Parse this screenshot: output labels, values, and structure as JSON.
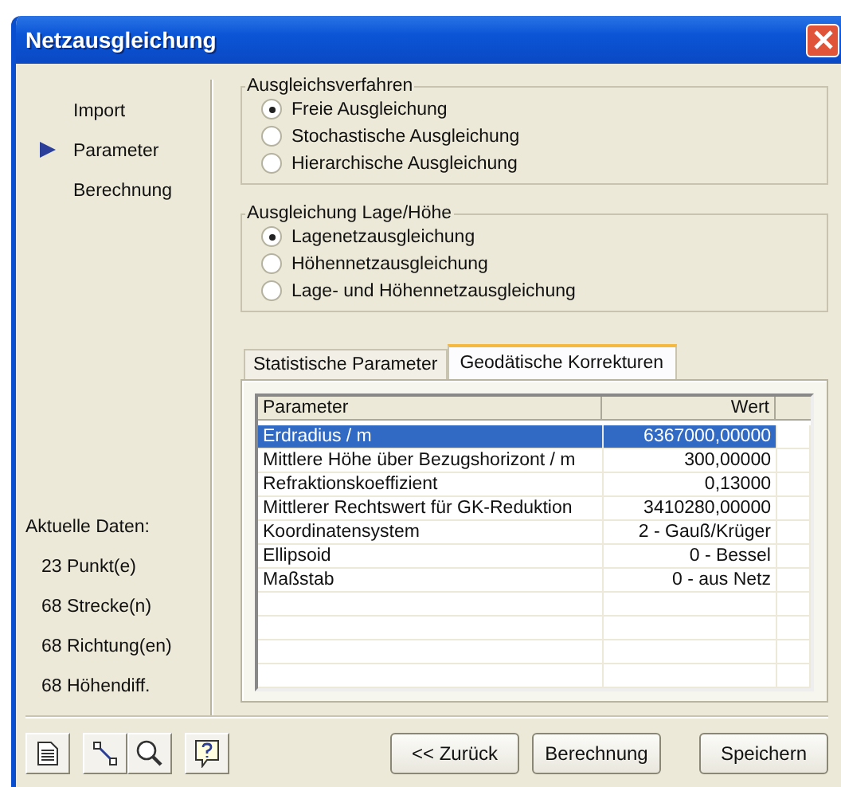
{
  "window": {
    "title": "Netzausgleichung"
  },
  "nav": [
    {
      "label": "Import",
      "selected": false
    },
    {
      "label": "Parameter",
      "selected": true
    },
    {
      "label": "Berechnung",
      "selected": false
    }
  ],
  "current_data": {
    "heading": "Aktuelle Daten:",
    "items": [
      "23 Punkt(e)",
      "68 Strecke(n)",
      "68 Richtung(en)",
      "68 Höhendiff."
    ]
  },
  "groups": [
    {
      "title": "Ausgleichsverfahren",
      "options": [
        {
          "label": "Freie Ausgleichung",
          "selected": true
        },
        {
          "label": "Stochastische Ausgleichung",
          "selected": false
        },
        {
          "label": "Hierarchische Ausgleichung",
          "selected": false
        }
      ]
    },
    {
      "title": "Ausgleichung Lage/Höhe",
      "options": [
        {
          "label": "Lagenetzausgleichung",
          "selected": true
        },
        {
          "label": "Höhennetzausgleichung",
          "selected": false
        },
        {
          "label": "Lage- und Höhennetzausgleichung",
          "selected": false
        }
      ]
    }
  ],
  "tabs": [
    {
      "label": "Statistische Parameter",
      "selected": false
    },
    {
      "label": "Geodätische Korrekturen",
      "selected": true
    }
  ],
  "table": {
    "columns": [
      "Parameter",
      "Wert"
    ],
    "rows": [
      {
        "parameter": "Erdradius / m",
        "value": "6367000,00000",
        "selected": true
      },
      {
        "parameter": "Mittlere Höhe über Bezugshorizont / m",
        "value": "300,00000",
        "selected": false
      },
      {
        "parameter": "Refraktionskoeffizient",
        "value": "0,13000",
        "selected": false
      },
      {
        "parameter": "Mittlerer Rechtswert für GK-Reduktion",
        "value": "3410280,00000",
        "selected": false
      },
      {
        "parameter": "Koordinatensystem",
        "value": "2 - Gauß/Krüger",
        "selected": false
      },
      {
        "parameter": "Ellipsoid",
        "value": "0 - Bessel",
        "selected": false
      },
      {
        "parameter": "Maßstab",
        "value": "0 - aus Netz",
        "selected": false
      }
    ]
  },
  "toolbar": [
    {
      "kind": "document"
    },
    {
      "kind": "fit"
    },
    {
      "kind": "zoom"
    },
    {
      "kind": "help"
    }
  ],
  "buttons": [
    "<< Zurück",
    "Berechnung",
    "Speichern"
  ]
}
